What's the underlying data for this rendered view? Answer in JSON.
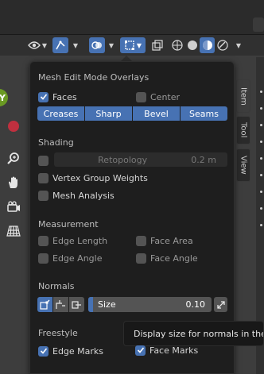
{
  "panel": {
    "section_overlays": "Mesh Edit Mode Overlays",
    "faces": {
      "label": "Faces",
      "checked": true
    },
    "center": {
      "label": "Center",
      "checked": false
    },
    "edge_display": [
      "Creases",
      "Sharp",
      "Bevel",
      "Seams"
    ],
    "section_shading": "Shading",
    "retopology": {
      "label": "Retopology",
      "value": "0.2 m",
      "checked": false
    },
    "vertex_group_weights": {
      "label": "Vertex Group Weights",
      "checked": false
    },
    "mesh_analysis": {
      "label": "Mesh Analysis",
      "checked": false
    },
    "section_measurement": "Measurement",
    "edge_length": {
      "label": "Edge Length",
      "checked": false
    },
    "face_area": {
      "label": "Face Area",
      "checked": false
    },
    "edge_angle": {
      "label": "Edge Angle",
      "checked": false
    },
    "face_angle": {
      "label": "Face Angle",
      "checked": false
    },
    "section_normals": "Normals",
    "normals_size": {
      "label": "Size",
      "value": "0.10"
    },
    "section_freestyle": "Freestyle",
    "edge_marks": {
      "label": "Edge Marks",
      "checked": true
    },
    "face_marks": {
      "label": "Face Marks",
      "checked": true
    }
  },
  "tooltip": "Display size for normals in the",
  "sidebar_tabs": [
    "Item",
    "Tool",
    "View"
  ],
  "nav_gizmo_axis": "Y",
  "icons": [
    "eye-icon",
    "gizmo-icon",
    "overlay-icon",
    "mesh-overlay-icon",
    "xray-icon",
    "wireframe-shading-icon",
    "solid-shading-icon",
    "material-shading-icon",
    "rendered-shading-icon",
    "zoom-icon",
    "hand-icon",
    "camera-icon",
    "grid-icon"
  ],
  "colors": {
    "accent": "#4772b3",
    "y_axis": "#6a9a23",
    "x_axis": "#c0303f"
  }
}
